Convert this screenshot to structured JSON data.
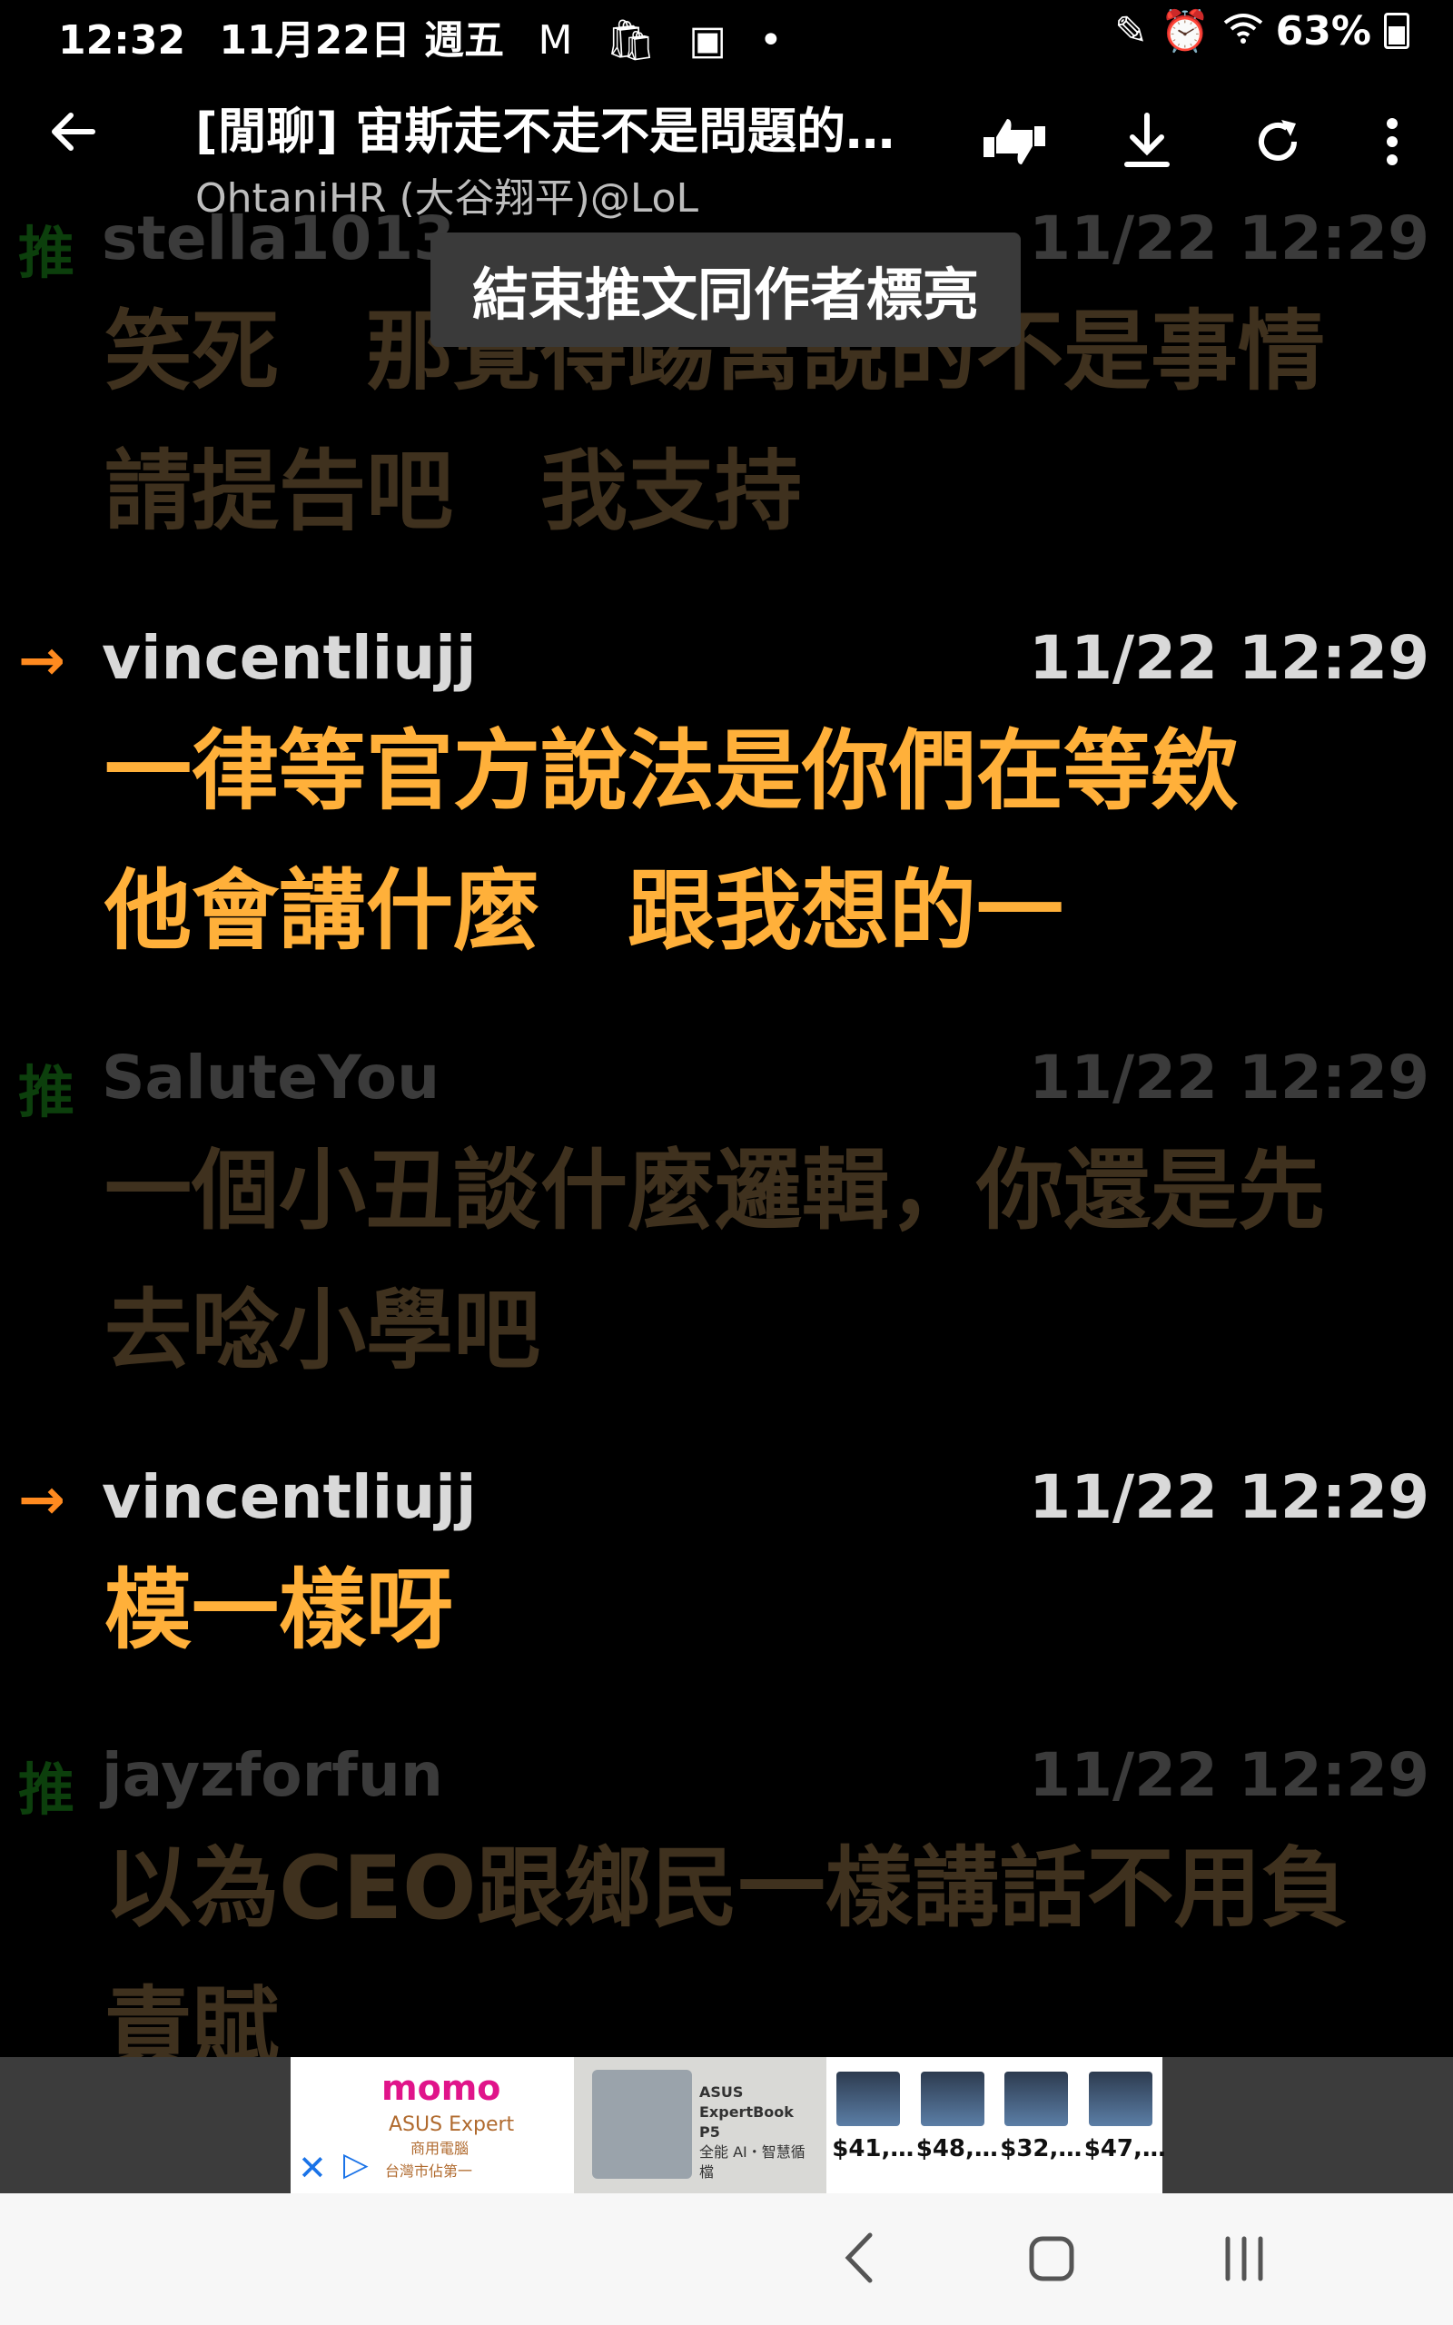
{
  "status": {
    "time": "12:32",
    "date": "11月22日 週五",
    "battery": "63%",
    "notif_icons": [
      "gmail-icon",
      "shopping-icon",
      "image-icon",
      "dot-icon"
    ],
    "right_icons": [
      "pen-icon",
      "alarm-icon",
      "wifi-icon"
    ]
  },
  "appbar": {
    "title": "[閒聊] 宙斯走不走不是問題的…",
    "subtitle": "OhtaniHR (大谷翔平)@LoL"
  },
  "tooltip": "結束推文同作者標亮",
  "comments": [
    {
      "tag": "推",
      "user": "stella1013",
      "time": "11/22 12:29",
      "lines": [
        "笑死　那覺得踢寓說的不是事情",
        "請提告吧　我支持"
      ]
    },
    {
      "tag": "→",
      "user": "vincentliujj",
      "time": "11/22 12:29",
      "lines": [
        "一律等官方說法是你們在等欸",
        "他會講什麼　跟我想的一"
      ]
    },
    {
      "tag": "推",
      "user": "SaluteYou",
      "time": "11/22 12:29",
      "lines": [
        "一個小丑談什麼邏輯，你還是先",
        "去唸小學吧"
      ]
    },
    {
      "tag": "→",
      "user": "vincentliujj",
      "time": "11/22 12:29",
      "lines": [
        "模一樣呀"
      ]
    },
    {
      "tag": "推",
      "user": "jayzforfun",
      "time": "11/22 12:29",
      "lines": [
        "以為CEO跟鄉民一樣講話不用負",
        "責賦"
      ]
    }
  ],
  "ad": {
    "brand": "momo",
    "sub1": "ASUS Expert",
    "sub2": "商用電腦",
    "sub3": "台灣市佔第一",
    "middle_title": "ASUS ExpertBook P5",
    "middle_sub": "全能 AI・智慧循檔",
    "prices": [
      "$41,…",
      "$48,…",
      "$32,…",
      "$47,…"
    ]
  },
  "colors": {
    "background": "#000000",
    "highlight_text": "#ffb03a",
    "arrow": "#ff8a1f",
    "dim_push": "#0c3f0c",
    "tooltip_bg": "#3a3a3a"
  }
}
